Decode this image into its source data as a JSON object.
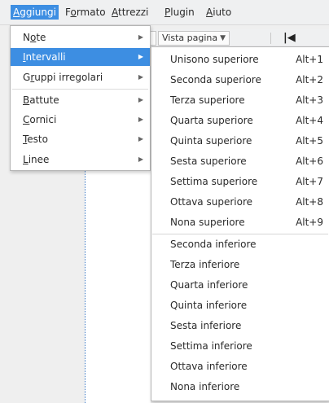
{
  "menubar": {
    "items": [
      {
        "mn": "A",
        "rest": "ggiungi"
      },
      {
        "pre": "F",
        "mn": "o",
        "rest": "rmato"
      },
      {
        "mn": "A",
        "rest": "ttrezzi"
      },
      {
        "mn": "P",
        "rest": "lugin"
      },
      {
        "mn": "A",
        "rest": "iuto"
      }
    ]
  },
  "toolbar": {
    "view_mode": "Vista pagina",
    "first_page_glyph": "|◀"
  },
  "menu": {
    "items": [
      {
        "pre": "N",
        "mn": "o",
        "rest": "te"
      },
      {
        "mn": "I",
        "rest": "ntervalli"
      },
      {
        "pre": "G",
        "mn": "r",
        "rest": "uppi irregolari"
      },
      {
        "mn": "B",
        "rest": "attute"
      },
      {
        "mn": "C",
        "rest": "ornici"
      },
      {
        "mn": "T",
        "rest": "esto"
      },
      {
        "mn": "L",
        "rest": "inee"
      }
    ]
  },
  "submenu": {
    "upper": [
      {
        "label": "Unisono superiore",
        "shortcut": "Alt+1"
      },
      {
        "label": "Seconda superiore",
        "shortcut": "Alt+2"
      },
      {
        "label": "Terza superiore",
        "shortcut": "Alt+3"
      },
      {
        "label": "Quarta superiore",
        "shortcut": "Alt+4"
      },
      {
        "label": "Quinta superiore",
        "shortcut": "Alt+5"
      },
      {
        "label": "Sesta superiore",
        "shortcut": "Alt+6"
      },
      {
        "label": "Settima superiore",
        "shortcut": "Alt+7"
      },
      {
        "label": "Ottava superiore",
        "shortcut": "Alt+8"
      },
      {
        "label": "Nona superiore",
        "shortcut": "Alt+9"
      }
    ],
    "lower": [
      {
        "label": "Seconda inferiore"
      },
      {
        "label": "Terza inferiore"
      },
      {
        "label": "Quarta inferiore"
      },
      {
        "label": "Quinta inferiore"
      },
      {
        "label": "Sesta inferiore"
      },
      {
        "label": "Settima inferiore"
      },
      {
        "label": "Ottava inferiore"
      },
      {
        "label": "Nona inferiore"
      }
    ]
  }
}
